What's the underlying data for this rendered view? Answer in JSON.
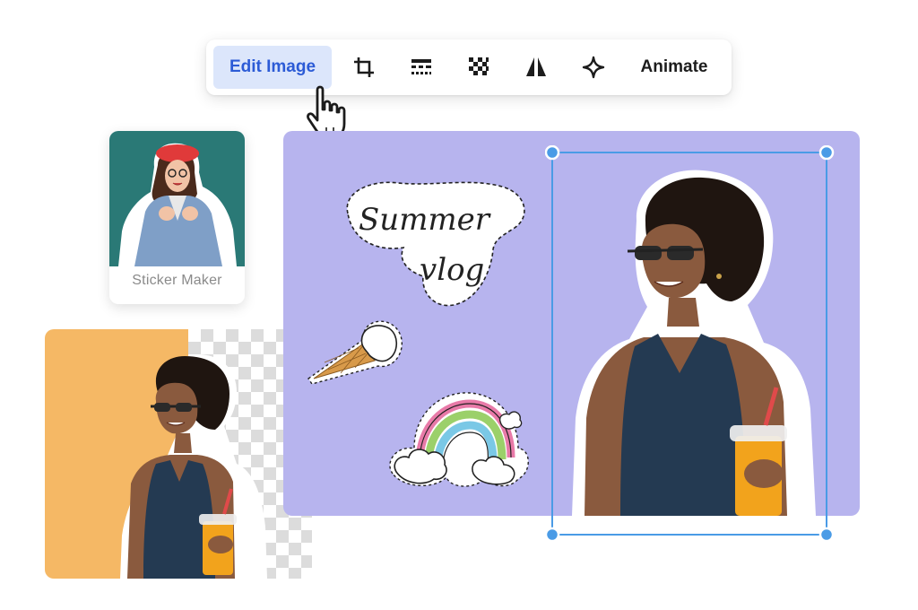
{
  "toolbar": {
    "edit_image_label": "Edit Image",
    "animate_label": "Animate",
    "tools": [
      {
        "icon": "crop-icon"
      },
      {
        "icon": "adjust-icon"
      },
      {
        "icon": "transparency-icon"
      },
      {
        "icon": "flip-icon"
      },
      {
        "icon": "magic-icon"
      }
    ]
  },
  "sticker_maker": {
    "label": "Sticker Maker"
  },
  "canvas": {
    "sticker_text_line1": "Summer",
    "sticker_text_line2": "vlog"
  },
  "colors": {
    "accent_blue": "#2c5bd6",
    "button_bg": "#dce6fb",
    "canvas_bg": "#b7b4ee",
    "selection": "#4a9be6",
    "sticker_card_bg": "#2a7976",
    "orange_bg": "#f5b865"
  }
}
